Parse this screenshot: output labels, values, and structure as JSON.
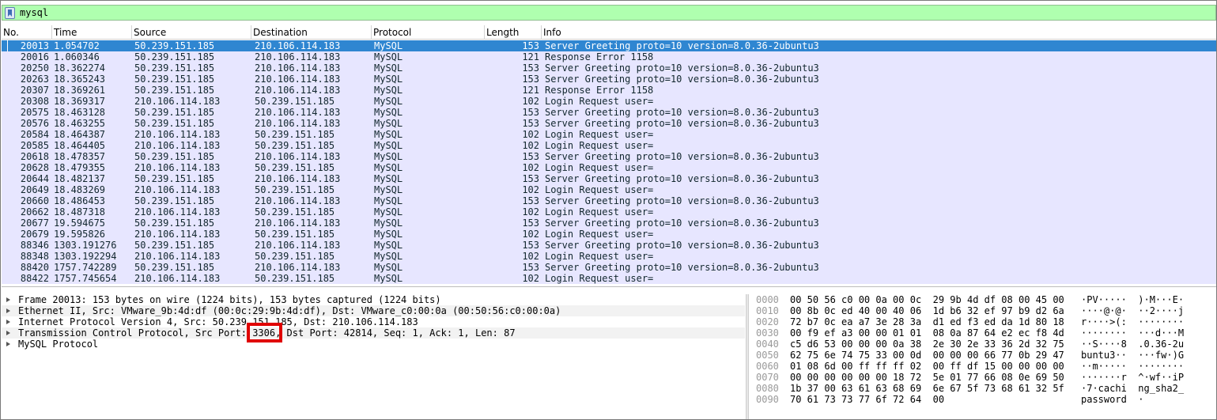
{
  "filter": {
    "text": "mysql"
  },
  "columns": [
    "No.",
    "Time",
    "Source",
    "Destination",
    "Protocol",
    "Length",
    "Info"
  ],
  "packets": [
    {
      "no": "20013",
      "time": "1.054702",
      "src": "50.239.151.185",
      "dst": "210.106.114.183",
      "proto": "MySQL",
      "len": "153",
      "info": "Server Greeting  proto=10 version=8.0.36-2ubuntu3",
      "selected": true
    },
    {
      "no": "20016",
      "time": "1.060346",
      "src": "50.239.151.185",
      "dst": "210.106.114.183",
      "proto": "MySQL",
      "len": "121",
      "info": "Response  Error 1158"
    },
    {
      "no": "20250",
      "time": "18.362274",
      "src": "50.239.151.185",
      "dst": "210.106.114.183",
      "proto": "MySQL",
      "len": "153",
      "info": "Server Greeting  proto=10 version=8.0.36-2ubuntu3"
    },
    {
      "no": "20263",
      "time": "18.365243",
      "src": "50.239.151.185",
      "dst": "210.106.114.183",
      "proto": "MySQL",
      "len": "153",
      "info": "Server Greeting  proto=10 version=8.0.36-2ubuntu3"
    },
    {
      "no": "20307",
      "time": "18.369261",
      "src": "50.239.151.185",
      "dst": "210.106.114.183",
      "proto": "MySQL",
      "len": "121",
      "info": "Response  Error 1158"
    },
    {
      "no": "20308",
      "time": "18.369317",
      "src": "210.106.114.183",
      "dst": "50.239.151.185",
      "proto": "MySQL",
      "len": "102",
      "info": "Login Request user="
    },
    {
      "no": "20575",
      "time": "18.463128",
      "src": "50.239.151.185",
      "dst": "210.106.114.183",
      "proto": "MySQL",
      "len": "153",
      "info": "Server Greeting  proto=10 version=8.0.36-2ubuntu3"
    },
    {
      "no": "20576",
      "time": "18.463255",
      "src": "50.239.151.185",
      "dst": "210.106.114.183",
      "proto": "MySQL",
      "len": "153",
      "info": "Server Greeting  proto=10 version=8.0.36-2ubuntu3"
    },
    {
      "no": "20584",
      "time": "18.464387",
      "src": "210.106.114.183",
      "dst": "50.239.151.185",
      "proto": "MySQL",
      "len": "102",
      "info": "Login Request user="
    },
    {
      "no": "20585",
      "time": "18.464405",
      "src": "210.106.114.183",
      "dst": "50.239.151.185",
      "proto": "MySQL",
      "len": "102",
      "info": "Login Request user="
    },
    {
      "no": "20618",
      "time": "18.478357",
      "src": "50.239.151.185",
      "dst": "210.106.114.183",
      "proto": "MySQL",
      "len": "153",
      "info": "Server Greeting  proto=10 version=8.0.36-2ubuntu3"
    },
    {
      "no": "20628",
      "time": "18.479355",
      "src": "210.106.114.183",
      "dst": "50.239.151.185",
      "proto": "MySQL",
      "len": "102",
      "info": "Login Request user="
    },
    {
      "no": "20644",
      "time": "18.482137",
      "src": "50.239.151.185",
      "dst": "210.106.114.183",
      "proto": "MySQL",
      "len": "153",
      "info": "Server Greeting  proto=10 version=8.0.36-2ubuntu3"
    },
    {
      "no": "20649",
      "time": "18.483269",
      "src": "210.106.114.183",
      "dst": "50.239.151.185",
      "proto": "MySQL",
      "len": "102",
      "info": "Login Request user="
    },
    {
      "no": "20660",
      "time": "18.486453",
      "src": "50.239.151.185",
      "dst": "210.106.114.183",
      "proto": "MySQL",
      "len": "153",
      "info": "Server Greeting  proto=10 version=8.0.36-2ubuntu3"
    },
    {
      "no": "20662",
      "time": "18.487318",
      "src": "210.106.114.183",
      "dst": "50.239.151.185",
      "proto": "MySQL",
      "len": "102",
      "info": "Login Request user="
    },
    {
      "no": "20677",
      "time": "19.594675",
      "src": "50.239.151.185",
      "dst": "210.106.114.183",
      "proto": "MySQL",
      "len": "153",
      "info": "Server Greeting  proto=10 version=8.0.36-2ubuntu3"
    },
    {
      "no": "20679",
      "time": "19.595826",
      "src": "210.106.114.183",
      "dst": "50.239.151.185",
      "proto": "MySQL",
      "len": "102",
      "info": "Login Request user="
    },
    {
      "no": "88346",
      "time": "1303.191276",
      "src": "50.239.151.185",
      "dst": "210.106.114.183",
      "proto": "MySQL",
      "len": "153",
      "info": "Server Greeting  proto=10 version=8.0.36-2ubuntu3"
    },
    {
      "no": "88348",
      "time": "1303.192294",
      "src": "210.106.114.183",
      "dst": "50.239.151.185",
      "proto": "MySQL",
      "len": "102",
      "info": "Login Request user="
    },
    {
      "no": "88420",
      "time": "1757.742289",
      "src": "50.239.151.185",
      "dst": "210.106.114.183",
      "proto": "MySQL",
      "len": "153",
      "info": "Server Greeting  proto=10 version=8.0.36-2ubuntu3"
    },
    {
      "no": "88422",
      "time": "1757.745654",
      "src": "210.106.114.183",
      "dst": "50.239.151.185",
      "proto": "MySQL",
      "len": "102",
      "info": "Login Request user="
    }
  ],
  "details": [
    "Frame 20013: 153 bytes on wire (1224 bits), 153 bytes captured (1224 bits)",
    "Ethernet II, Src: VMware_9b:4d:df (00:0c:29:9b:4d:df), Dst: VMware_c0:00:0a (00:50:56:c0:00:0a)",
    "Internet Protocol Version 4, Src: 50.239.151.185, Dst: 210.106.114.183",
    "Transmission Control Protocol, Src Port: 3306, Dst Port: 42814, Seq: 1, Ack: 1, Len: 87",
    "MySQL Protocol"
  ],
  "bytes": [
    {
      "off": "0000",
      "hex": "00 50 56 c0 00 0a 00 0c  29 9b 4d df 08 00 45 00",
      "ascii": "·PV·····  )·M···E·"
    },
    {
      "off": "0010",
      "hex": "00 8b 0c ed 40 00 40 06  1d b6 32 ef 97 b9 d2 6a",
      "ascii": "····@·@·  ··2····j"
    },
    {
      "off": "0020",
      "hex": "72 b7 0c ea a7 3e 28 3a  d1 ed f3 ed da 1d 80 18",
      "ascii": "r····>(:  ········"
    },
    {
      "off": "0030",
      "hex": "00 f9 ef a3 00 00 01 01  08 0a 87 64 e2 ec f8 4d",
      "ascii": "········  ···d···M"
    },
    {
      "off": "0040",
      "hex": "c5 d6 53 00 00 00 0a 38  2e 30 2e 33 36 2d 32 75",
      "ascii": "··S····8  .0.36-2u"
    },
    {
      "off": "0050",
      "hex": "62 75 6e 74 75 33 00 0d  00 00 00 66 77 0b 29 47",
      "ascii": "buntu3··  ···fw·)G"
    },
    {
      "off": "0060",
      "hex": "01 08 6d 00 ff ff ff 02  00 ff df 15 00 00 00 00",
      "ascii": "··m·····  ········"
    },
    {
      "off": "0070",
      "hex": "00 00 00 00 00 00 18 72  5e 01 77 66 08 0e 69 50",
      "ascii": "·······r  ^·wf··iP"
    },
    {
      "off": "0080",
      "hex": "1b 37 00 63 61 63 68 69  6e 67 5f 73 68 61 32 5f",
      "ascii": "·7·cachi  ng_sha2_"
    },
    {
      "off": "0090",
      "hex": "70 61 73 73 77 6f 72 64  00",
      "ascii": "password  ·"
    }
  ]
}
